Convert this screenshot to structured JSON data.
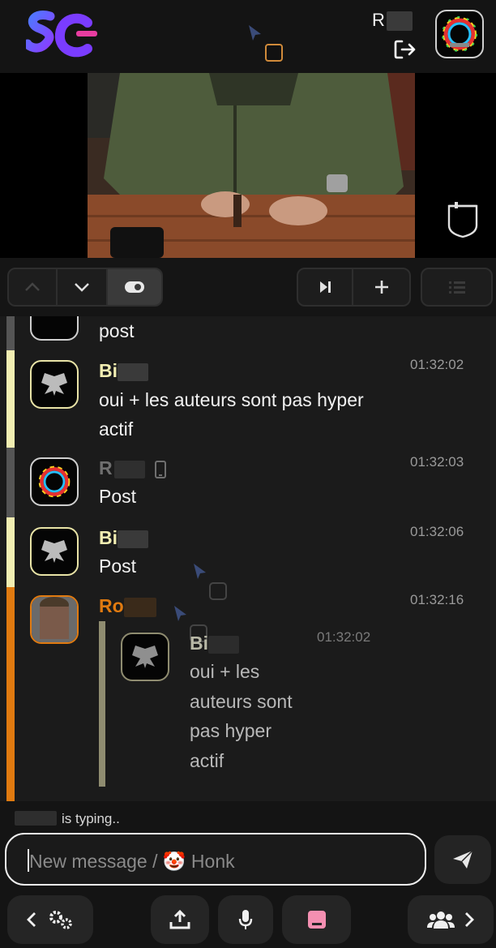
{
  "header": {
    "user_name": "R",
    "logo_letters": "SC"
  },
  "toolbar": {
    "buttons": [
      "up",
      "down",
      "toggle",
      "skip-next",
      "add",
      "list"
    ]
  },
  "messages": [
    {
      "author": "",
      "text": "post",
      "time": "",
      "bar_color": "#555555"
    },
    {
      "author": "Bi",
      "text_lines": [
        "oui + les auteurs sont pas hyper",
        "actif"
      ],
      "time": "01:32:02",
      "bar_color": "#f2eeb2",
      "author_color": "#f2eeb2"
    },
    {
      "author": "R",
      "text": "Post",
      "time": "01:32:03",
      "bar_color": "#555555",
      "author_color": "#6f6f6f"
    },
    {
      "author": "Bi",
      "text": "Post",
      "time": "01:32:06",
      "bar_color": "#f2eeb2",
      "author_color": "#f2eeb2"
    },
    {
      "author": "Ro",
      "time": "01:32:16",
      "bar_color": "#e07a10",
      "author_color": "#e07a10",
      "quote": {
        "author": "Bi",
        "time": "01:32:02",
        "text_lines": [
          "oui + les",
          "auteurs sont",
          "pas hyper",
          "actif"
        ]
      }
    }
  ],
  "typing": {
    "text": "is typing.."
  },
  "composer": {
    "placeholder_prefix": "New message / ",
    "emoji": "🤡",
    "placeholder_suffix": " Honk"
  },
  "colors": {
    "accent_yellow": "#f2eeb2",
    "accent_orange": "#e07a10",
    "background": "#1b1b1b"
  }
}
